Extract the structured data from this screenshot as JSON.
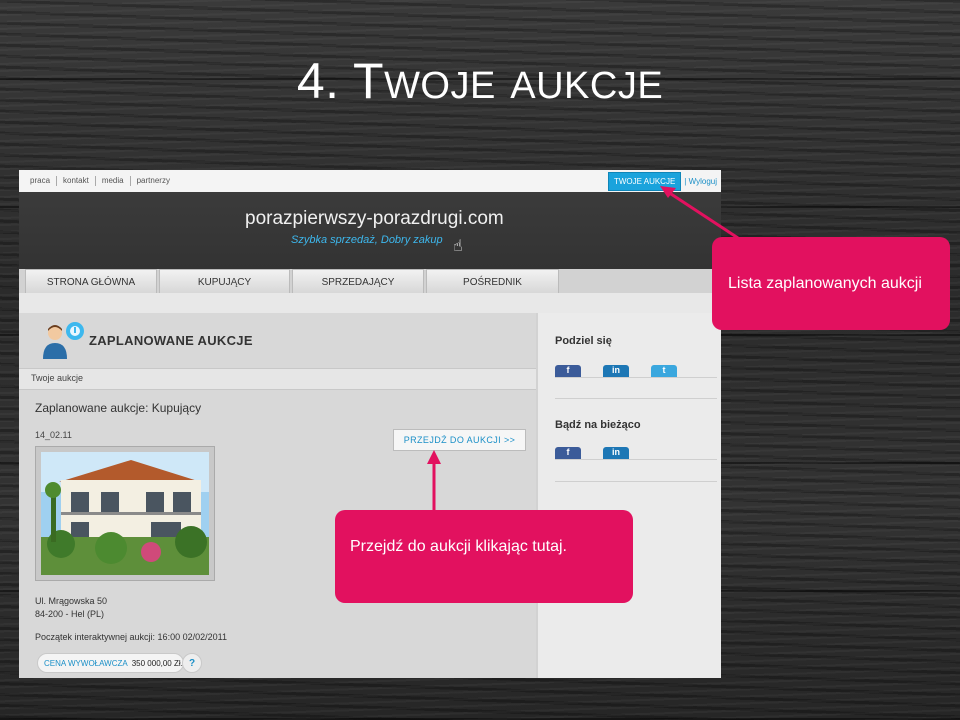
{
  "slide": {
    "number": "4.",
    "title_first": "T",
    "title_rest_1": "WOJE",
    "title_rest_2": "AUKCJE"
  },
  "topnav": [
    "praca",
    "kontakt",
    "media",
    "partnerzy"
  ],
  "account": {
    "my_auctions": "TWOJE AUKCJE",
    "logout": "Wyloguj"
  },
  "header": {
    "logo": "porazpierwszy-porazdrugi.com",
    "tagline": "Szybka sprzedaż, Dobry zakup"
  },
  "tabs": [
    "STRONA GŁÓWNA",
    "KUPUJĄCY",
    "SPRZEDAJĄCY",
    "POŚREDNIK"
  ],
  "main": {
    "heading": "ZAPLANOWANE AUKCJE",
    "breadcrumb": "Twoje aukcje",
    "subheading": "Zaplanowane aukcje: Kupujący",
    "date": "14_02.11",
    "go_button": "PRZEJDŹ DO AUKCJI >>",
    "address_line1": "Ul. Mrągowska 50",
    "address_line2": "84-200 - Hel (PL)",
    "start_text": "Początek interaktywnej aukcji: 16:00 02/02/2011",
    "price_label": "CENA WYWOŁAWCZA",
    "price_value": "350 000,00 Zł.",
    "help": "?"
  },
  "sidebar": {
    "share_heading": "Podziel się",
    "ahead_heading": "Bądź na bieżąco",
    "share_icons": [
      {
        "name": "facebook",
        "glyph": "f"
      },
      {
        "name": "linkedin",
        "glyph": "in"
      },
      {
        "name": "twitter",
        "glyph": "t"
      }
    ],
    "ahead_icons": [
      {
        "name": "facebook",
        "glyph": "f"
      },
      {
        "name": "linkedin",
        "glyph": "in"
      }
    ]
  },
  "callouts": {
    "list": "Lista zaplanowanych aukcji",
    "go": "Przejdź do aukcji klikając tutaj."
  },
  "colors": {
    "accent_pink": "#e2115f",
    "link_blue": "#1a8fc7",
    "button_blue": "#1aa3dc"
  }
}
